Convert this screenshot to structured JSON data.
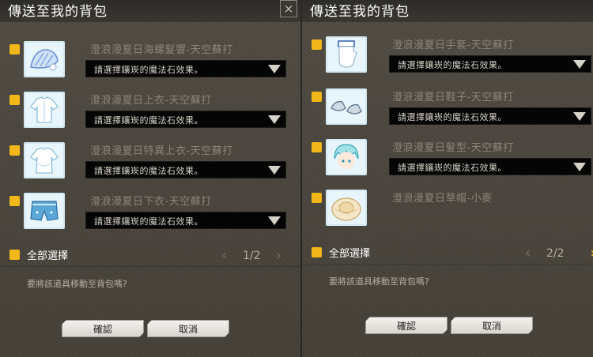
{
  "panels": [
    {
      "title": "傳送至我的背包",
      "close_icon": "×",
      "items": [
        {
          "name": "澄浪漫夏日海螺髮響-天空蘇打",
          "option": "請選擇鑲崁的魔法石效果。",
          "icon": "seashell-hairpin-icon"
        },
        {
          "name": "澄浪漫夏日上衣-天空蘇打",
          "option": "請選擇鑲崁的魔法石效果。",
          "icon": "shirt-icon"
        },
        {
          "name": "澄浪漫夏日特異上衣-天空蘇打",
          "option": "請選擇鑲崁的魔法石效果。",
          "icon": "special-shirt-icon"
        },
        {
          "name": "澄浪漫夏日下衣-天空蘇打",
          "option": "請選擇鑲崁的魔法石效果。",
          "icon": "shorts-icon"
        }
      ],
      "select_all": "全部選擇",
      "page": "1/2",
      "question": "要將該道具移動至背包嗎?",
      "confirm": "確認",
      "cancel": "取消"
    },
    {
      "title": "傳送至我的背包",
      "items": [
        {
          "name": "澄浪漫夏日手套-天空蘇打",
          "option": "請選擇鑲崁的魔法石效果。",
          "icon": "glove-icon"
        },
        {
          "name": "澄浪漫夏日鞋子-天空蘇打",
          "option": "請選擇鑲崁的魔法石效果。",
          "icon": "shoes-icon"
        },
        {
          "name": "澄浪漫夏日髮型-天空蘇打",
          "option": "請選擇鑲崁的魔法石效果。",
          "icon": "hairstyle-icon"
        },
        {
          "name": "澄浪漫夏日草帽-小麥",
          "icon": "straw-hat-icon"
        }
      ],
      "select_all": "全部選擇",
      "page": "2/2",
      "question": "要將該道具移動至背包嗎?",
      "confirm": "確認",
      "cancel": "取消"
    }
  ],
  "colors": {
    "checkbox": "#f2b81a",
    "pager_active_arrow": "#f2b81a",
    "pager_inactive_arrow": "#6b665d"
  }
}
